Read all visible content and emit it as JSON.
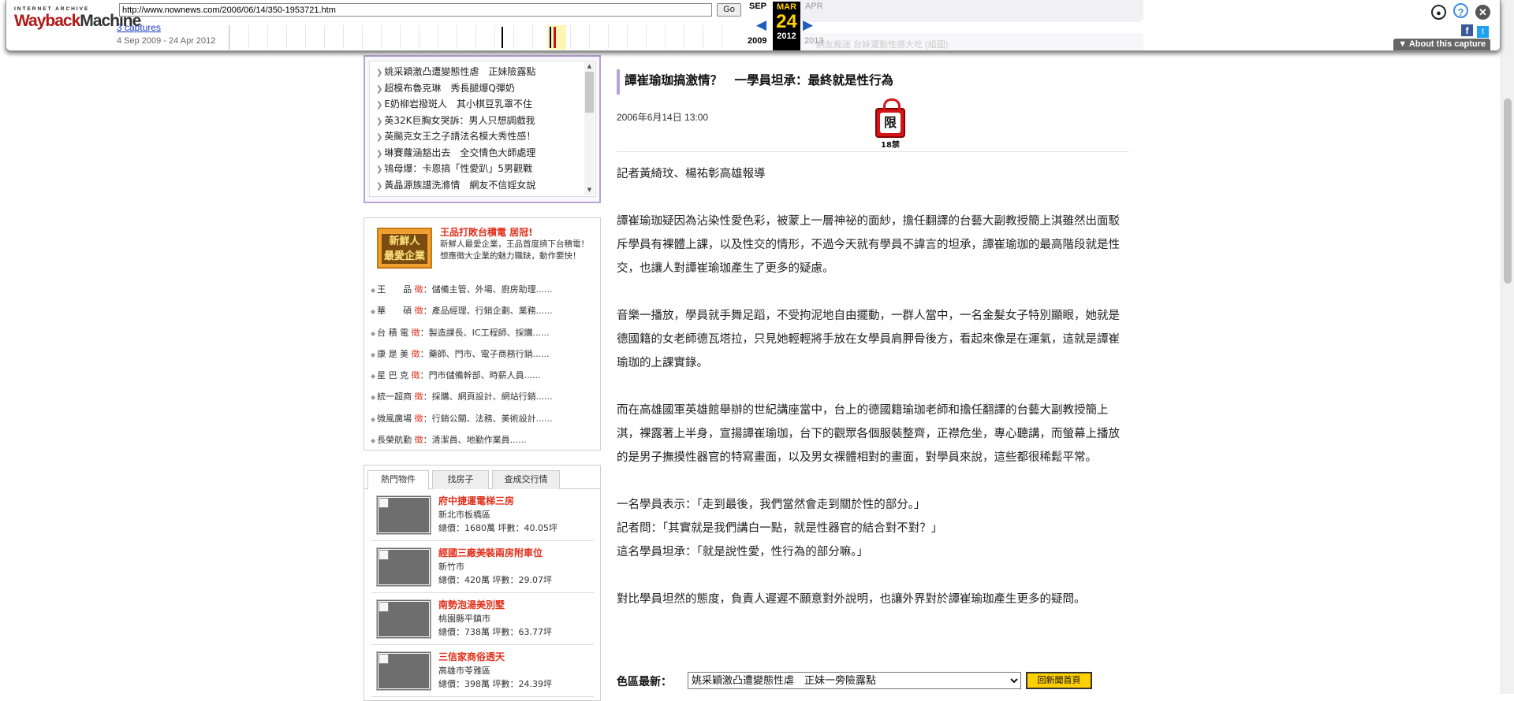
{
  "wayback": {
    "logo_top": "INTERNET ARCHIVE",
    "logo_main_a": "Wayback",
    "logo_main_b": "Machine",
    "url": "http://www.nownews.com/2006/06/14/350-1953721.htm",
    "go_label": "Go",
    "captures_link": "3 captures",
    "date_range": "4 Sep 2009 - 24 Apr 2012",
    "cal": {
      "prev_month": "SEP",
      "cur_month": "MAR",
      "cur_day": "24",
      "next_month": "APR",
      "prev_year": "2009",
      "cur_year": "2012",
      "next_year": "2013"
    },
    "about_label": "▼ About this capture",
    "ghost_text": "網友痴迷 台妹運動性感大吃 (組圖)"
  },
  "news_list": [
    "姚采穎激凸遭變態性虐　正妹險露點",
    "超模布魯克琳　秀長腿爆Q彈奶",
    "E奶柳岩撥斑人　其小棋豆乳罩不住",
    "英32K巨胸女哭訴：男人只想調戲我",
    "英飈克女王之子請法名模大秀性感！",
    "琳賽蘿涵豁出去　全交情色大師處理",
    "鴇母爆：卡恩搞「性愛趴」5男觀戰",
    "黃晶源族譜洗滌情　網友不信婬女說"
  ],
  "jobs": {
    "logo_line1": "新鮮人",
    "logo_line2": "最愛企業",
    "title": "王品打敗台積電 居冠!",
    "desc": "新鮮人最愛企業，王品首度擠下台積電！想應徵大企業的魅力職缺，動作要快！",
    "rows": [
      {
        "company": "王　　品",
        "mark": "徵",
        "roles": "：儲備主管、外場、廚房助理......"
      },
      {
        "company": "華　　碩",
        "mark": "徵",
        "roles": "：產品經理、行銷企劃、業務......"
      },
      {
        "company": "台 積 電",
        "mark": "徵",
        "roles": "：製造課長、IC工程師、採購......"
      },
      {
        "company": "康 是 美",
        "mark": "徵",
        "roles": "：藥師、門市、電子商務行銷......"
      },
      {
        "company": "星 巴 克",
        "mark": "徵",
        "roles": "：門市儲備幹部、時薪人員......"
      },
      {
        "company": "統一超商",
        "mark": "徵",
        "roles": "：採購、網頁設計、網站行銷......"
      },
      {
        "company": "微風廣場",
        "mark": "徵",
        "roles": "：行銷公關、法務、美術設計......"
      },
      {
        "company": "長榮航勤",
        "mark": "徵",
        "roles": "：清潔員、地勤作業員......"
      }
    ]
  },
  "houses": {
    "tabs": [
      "熱門物件",
      "找房子",
      "查成交行情"
    ],
    "items": [
      {
        "name": "府中捷運電梯三房",
        "loc": "新北市板橋區",
        "price": "總價：1680萬 坪數：40.05坪"
      },
      {
        "name": "經國三廠美裝兩房附車位",
        "loc": "新竹市",
        "price": "總價：420萬 坪數：29.07坪"
      },
      {
        "name": "南勢泡湯美別墅",
        "loc": "桃園縣平鎮市",
        "price": "總價：738萬 坪數：63.77坪"
      },
      {
        "name": "三信家商俗透天",
        "loc": "高雄市苓雅區",
        "price": "總價：398萬 坪數：24.39坪"
      }
    ]
  },
  "article": {
    "title": "譚崔瑜珈搞激情？　一學員坦承：最終就是性行為",
    "date": "2006年6月14日 13:00",
    "rating_label": "限",
    "rating_age": "18禁",
    "byline": "記者黃綺玟、楊祐彰高雄報導",
    "p1": "譚崔瑜珈疑因為沾染性愛色彩，被蒙上一層神祕的面紗，擔任翻譯的台藝大副教授簡上淇雖然出面駁斥學員有裸體上課，以及性交的情形，不過今天就有學員不諱言的坦承，譚崔瑜珈的最高階段就是性交，也讓人對譚崔瑜珈產生了更多的疑慮。",
    "p2": "音樂一播放，學員就手舞足蹈，不受拘泥地自由擺動，一群人當中，一名金髮女子特別顯眼，她就是德國籍的女老師德瓦塔拉，只見她輕輕將手放在女學員肩胛骨後方，看起來像是在運氣，這就是譚崔瑜珈的上課實錄。",
    "p3": "而在高雄國軍英雄館舉辦的世紀講座當中，台上的德國籍瑜珈老師和擔任翻譯的台藝大副教授簡上淇，裸露著上半身，宣揚譚崔瑜珈，台下的觀眾各個服裝整齊，正襟危坐，專心聽講，而螢幕上播放的是男子撫摸性器官的特寫畫面，以及男女裸體相對的畫面，對學員來說，這些都很稀鬆平常。",
    "q1": "一名學員表示：「走到最後，我們當然會走到關於性的部分。」",
    "q2": "記者問：「其實就是我們講白一點，就是性器官的結合對不對？」",
    "q3": "這名學員坦承：「就是說性愛，性行為的部分嘛。」",
    "p4": "對比學員坦然的態度，負責人遲遲不願意對外說明，也讓外界對於譚崔瑜珈產生更多的疑問。",
    "latest_label": "色區最新：",
    "latest_selected": "姚采穎激凸遭變態性虐　正妹一旁險露點",
    "home_button": "回新聞首頁"
  },
  "colors": {
    "accent_purple": "#b9a3d4",
    "red_link": "#e2301c",
    "wayback_red": "#b01818"
  }
}
